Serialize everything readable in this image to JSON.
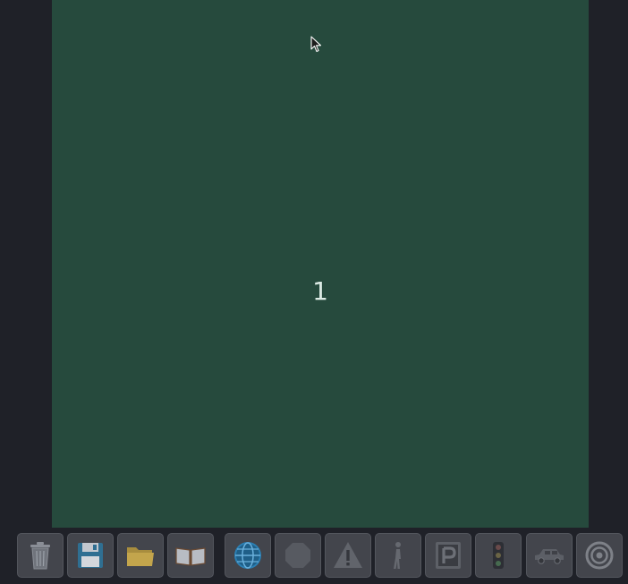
{
  "stage": {
    "value": "1"
  },
  "toolbar": {
    "buttons": [
      {
        "id": "trash",
        "icon": "trash-icon"
      },
      {
        "id": "save",
        "icon": "floppy-disk-icon"
      },
      {
        "id": "open",
        "icon": "folder-icon"
      },
      {
        "id": "book",
        "icon": "open-book-icon"
      },
      {
        "id": "globe",
        "icon": "globe-icon"
      },
      {
        "id": "stop",
        "icon": "octagon-stop-icon"
      },
      {
        "id": "warning",
        "icon": "warning-triangle-icon"
      },
      {
        "id": "pedestrian",
        "icon": "pedestrian-icon"
      },
      {
        "id": "parking",
        "icon": "parking-sign-icon"
      },
      {
        "id": "traffic-light",
        "icon": "traffic-light-icon"
      },
      {
        "id": "car",
        "icon": "car-icon"
      },
      {
        "id": "target",
        "icon": "target-icon"
      }
    ]
  },
  "colors": {
    "background": "#1f2128",
    "stage": "#264a3d",
    "button": "#43454c",
    "globe_accent": "#2b7fb3"
  }
}
